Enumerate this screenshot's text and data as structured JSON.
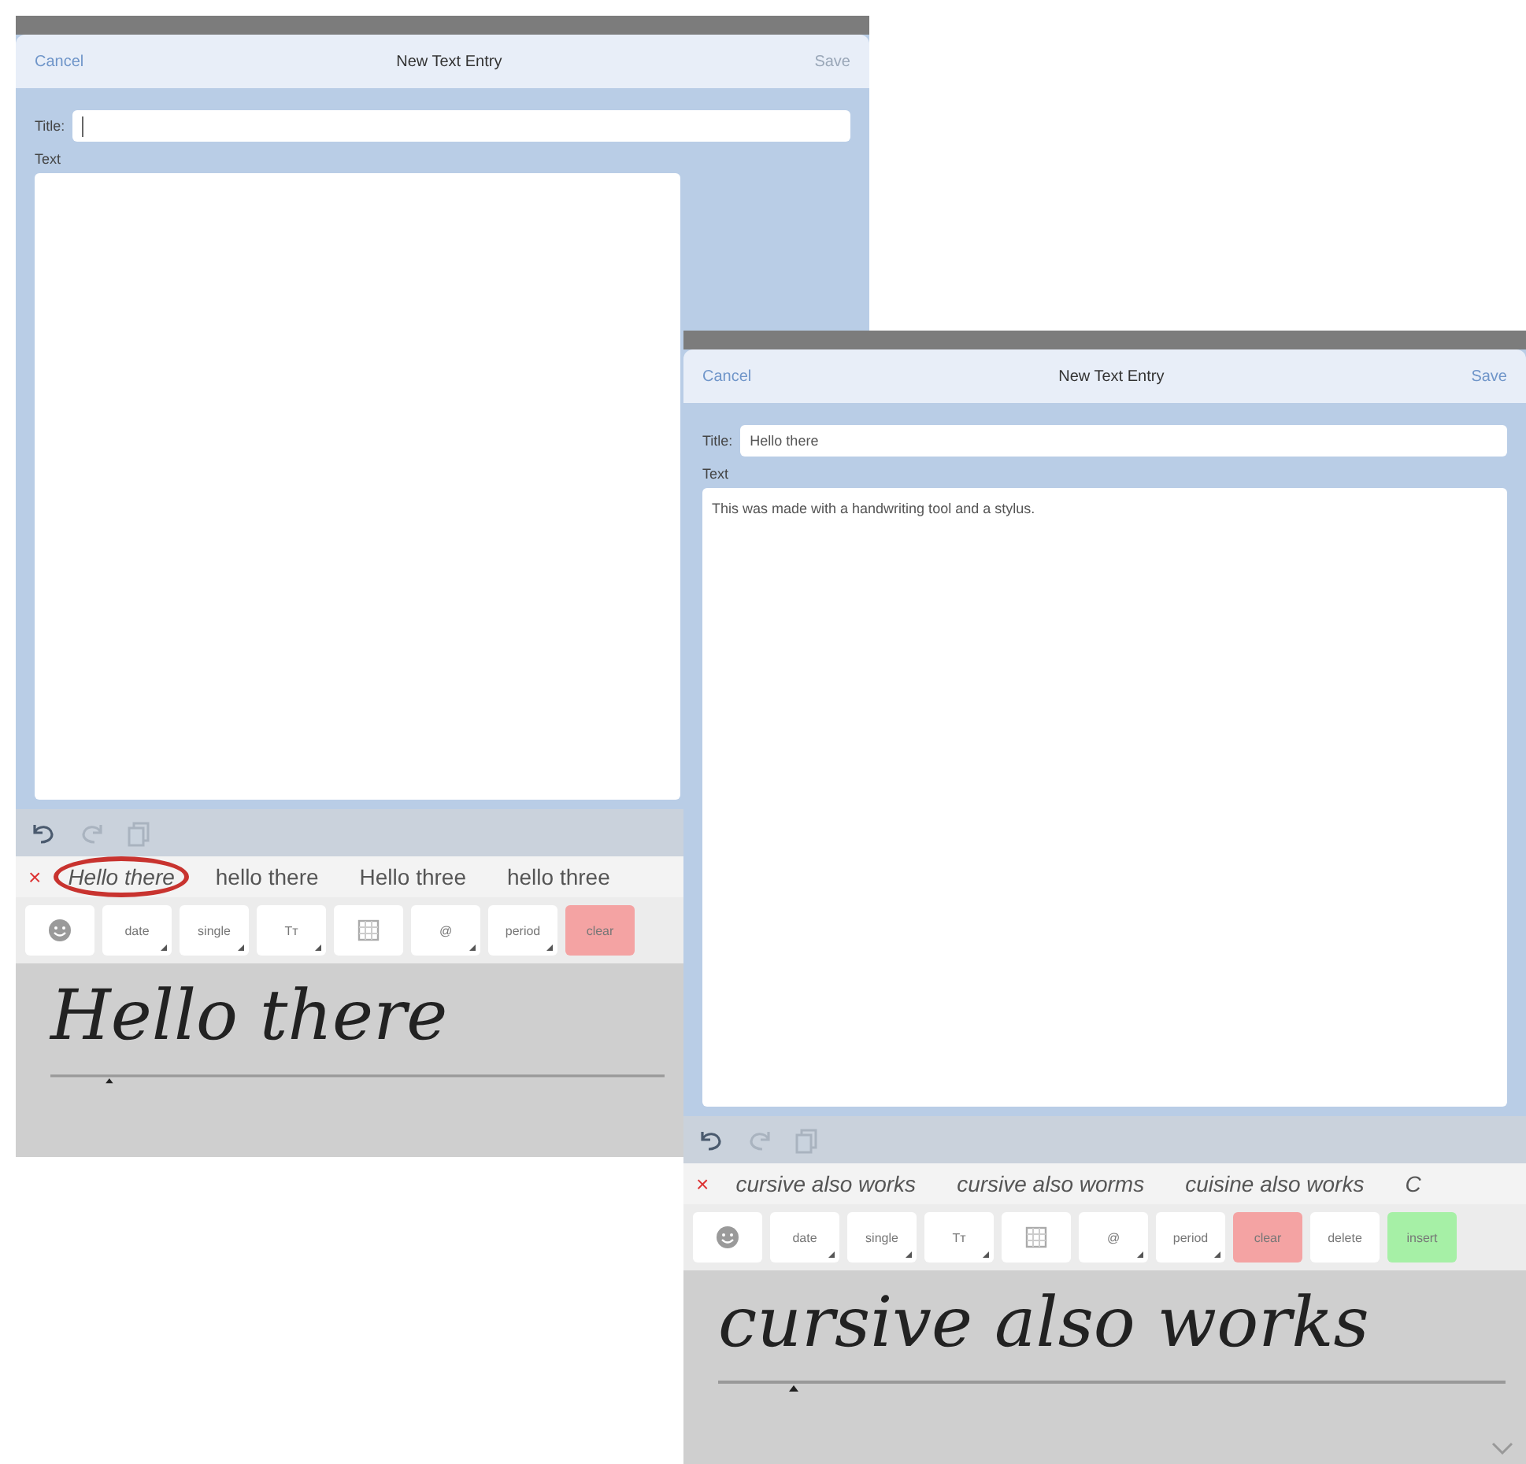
{
  "screens": [
    {
      "nav": {
        "cancel": "Cancel",
        "title": "New Text Entry",
        "save": "Save",
        "save_disabled": true
      },
      "form": {
        "title_label": "Title:",
        "text_label": "Text"
      },
      "edit_tools": [
        {
          "kind": "undo",
          "disabled": false
        },
        {
          "kind": "redo",
          "disabled": true
        },
        {
          "kind": "copy",
          "disabled": true
        }
      ],
      "candidates": {
        "close": "×",
        "items": [
          {
            "text": "Hello there",
            "circled": true
          },
          {
            "text": "hello there",
            "circled": false
          },
          {
            "text": "Hello three",
            "circled": false
          },
          {
            "text": "hello three",
            "circled": false
          }
        ]
      },
      "buttons": [
        {
          "kind": "face",
          "menu": false,
          "color": "#ffffff"
        },
        {
          "kind": "text",
          "label": "date",
          "menu": true,
          "color": "#ffffff"
        },
        {
          "kind": "text",
          "label": "single",
          "menu": true,
          "color": "#ffffff"
        },
        {
          "kind": "text",
          "label": "Tт",
          "menu": true,
          "color": "#ffffff"
        },
        {
          "kind": "grid",
          "menu": false,
          "color": "#ffffff"
        },
        {
          "kind": "text",
          "label": "@",
          "menu": true,
          "color": "#ffffff"
        },
        {
          "kind": "text",
          "label": "period",
          "menu": true,
          "color": "#ffffff"
        },
        {
          "kind": "text",
          "label": "clear",
          "menu": false,
          "color": "#f4a3a3"
        }
      ],
      "ink": "Hello there"
    },
    {
      "nav": {
        "cancel": "Cancel",
        "title": "New Text Entry",
        "save": "Save",
        "save_disabled": false
      },
      "form": {
        "title_label": "Title:",
        "title_value": "Hello there",
        "text_label": "Text",
        "text_value": "This was made with a handwriting tool and a stylus."
      },
      "edit_tools": [
        {
          "kind": "undo",
          "disabled": false
        },
        {
          "kind": "redo",
          "disabled": true
        },
        {
          "kind": "copy",
          "disabled": true
        }
      ],
      "candidates": {
        "close": "×",
        "items": [
          {
            "text": "cursive also works"
          },
          {
            "text": "cursive also worms"
          },
          {
            "text": "cuisine also works"
          },
          {
            "text": "C"
          }
        ]
      },
      "buttons": [
        {
          "kind": "face",
          "menu": false,
          "color": "#ffffff"
        },
        {
          "kind": "text",
          "label": "date",
          "menu": true,
          "color": "#ffffff"
        },
        {
          "kind": "text",
          "label": "single",
          "menu": true,
          "color": "#ffffff"
        },
        {
          "kind": "text",
          "label": "Tт",
          "menu": true,
          "color": "#ffffff"
        },
        {
          "kind": "grid",
          "menu": false,
          "color": "#ffffff"
        },
        {
          "kind": "text",
          "label": "@",
          "menu": true,
          "color": "#ffffff"
        },
        {
          "kind": "text",
          "label": "period",
          "menu": true,
          "color": "#ffffff"
        },
        {
          "kind": "text",
          "label": "clear",
          "menu": false,
          "color": "#f4a3a3"
        },
        {
          "kind": "text",
          "label": "delete",
          "menu": false,
          "color": "#ffffff"
        },
        {
          "kind": "text",
          "label": "insert",
          "menu": false,
          "color": "#a6f0a6"
        }
      ],
      "ink": "cursive also works"
    }
  ]
}
